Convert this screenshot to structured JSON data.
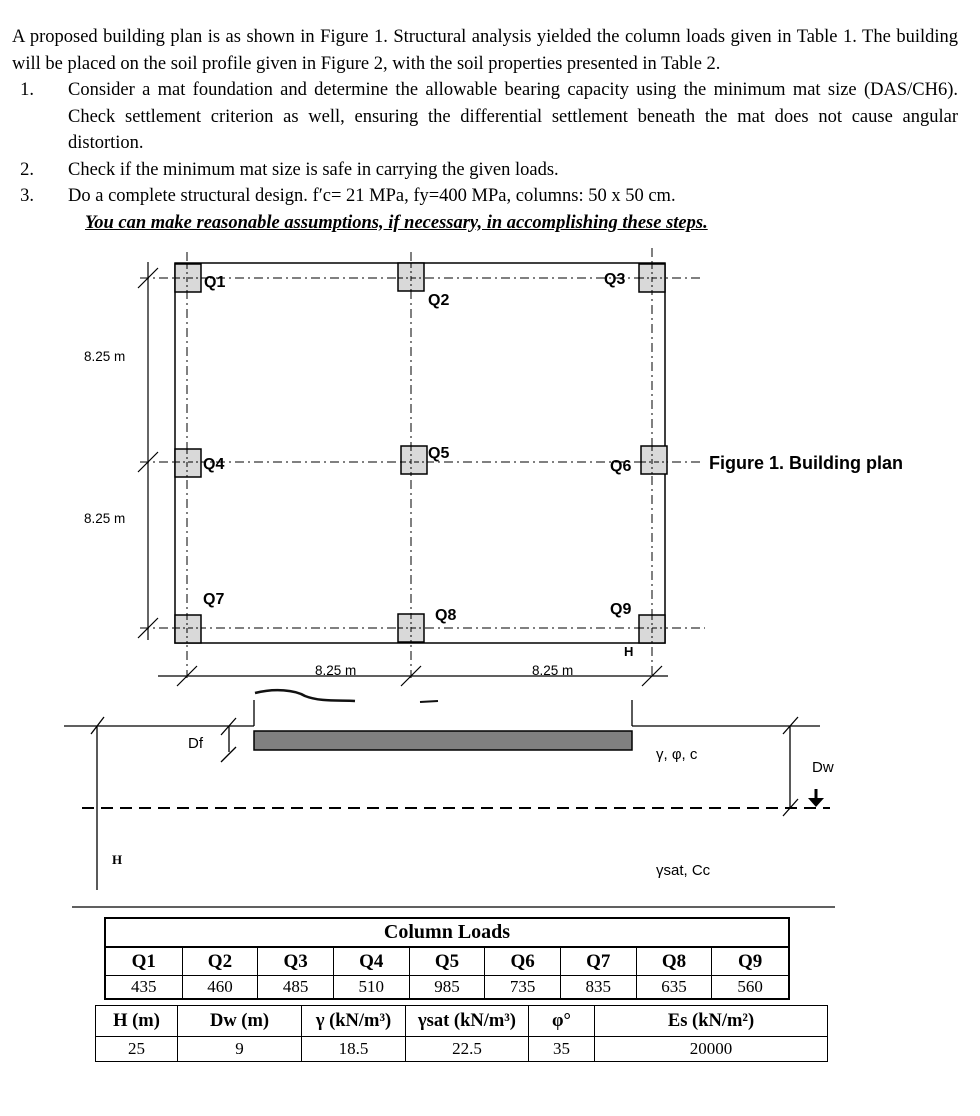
{
  "problem": {
    "intro": "A proposed building plan is as shown in Figure 1. Structural analysis yielded the column loads given in Table 1. The building will be placed on the soil profile given in Figure 2, with the soil properties presented in Table 2.",
    "items": [
      {
        "num": "1.",
        "text": "Consider a mat foundation and determine the allowable bearing capacity using the minimum mat size (DAS/CH6). Check settlement criterion as well, ensuring the differential settlement beneath the mat does not cause angular distortion."
      },
      {
        "num": "2.",
        "text": "Check if the minimum mat size is safe in carrying the given loads."
      },
      {
        "num": "3.",
        "text": "Do a complete structural design. f′c= 21 MPa, fy=400 MPa, columns: 50 x 50 cm."
      }
    ],
    "note": "You can make reasonable assumptions, if necessary, in accomplishing these steps."
  },
  "figure1": {
    "caption": "Figure 1. Building plan",
    "columns": [
      "Q1",
      "Q2",
      "Q3",
      "Q4",
      "Q5",
      "Q6",
      "Q7",
      "Q8",
      "Q9"
    ],
    "dim_vertical": [
      "8.25 m",
      "8.25 m"
    ],
    "dim_horizontal": [
      "8.25 m",
      "8.25 m"
    ],
    "corner_label": "H"
  },
  "figure2": {
    "df_label": "Df",
    "dw_label": "Dw",
    "h_label": "H",
    "upper_layer": "γ, φ, c",
    "lower_layer": "γsat, Cc"
  },
  "table1": {
    "title": "Column Loads",
    "headers": [
      "Q1",
      "Q2",
      "Q3",
      "Q4",
      "Q5",
      "Q6",
      "Q7",
      "Q8",
      "Q9"
    ],
    "values": [
      "435",
      "460",
      "485",
      "510",
      "985",
      "735",
      "835",
      "635",
      "560"
    ]
  },
  "table2": {
    "headers": [
      "H (m)",
      "Dw (m)",
      "γ (kN/m³)",
      "γsat (kN/m³)",
      "φ°",
      "Es (kN/m²)"
    ],
    "values": [
      "25",
      "9",
      "18.5",
      "22.5",
      "35",
      "20000"
    ]
  }
}
